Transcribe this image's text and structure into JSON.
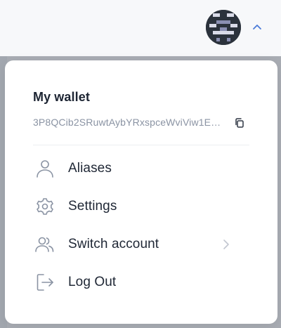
{
  "header": {
    "avatar_icon": "identicon-avatar",
    "toggle_icon": "chevron-up-icon",
    "accent_color": "#4a7bd8"
  },
  "wallet": {
    "title": "My wallet",
    "address": "3P8QCib2SRuwtAybYRxspceWviViw1E1…",
    "copy_icon": "copy-icon"
  },
  "menu": {
    "items": [
      {
        "label": "Aliases",
        "icon": "user-icon"
      },
      {
        "label": "Settings",
        "icon": "gear-icon"
      },
      {
        "label": "Switch account",
        "icon": "users-icon",
        "has_submenu": true
      },
      {
        "label": "Log Out",
        "icon": "logout-icon"
      }
    ]
  }
}
